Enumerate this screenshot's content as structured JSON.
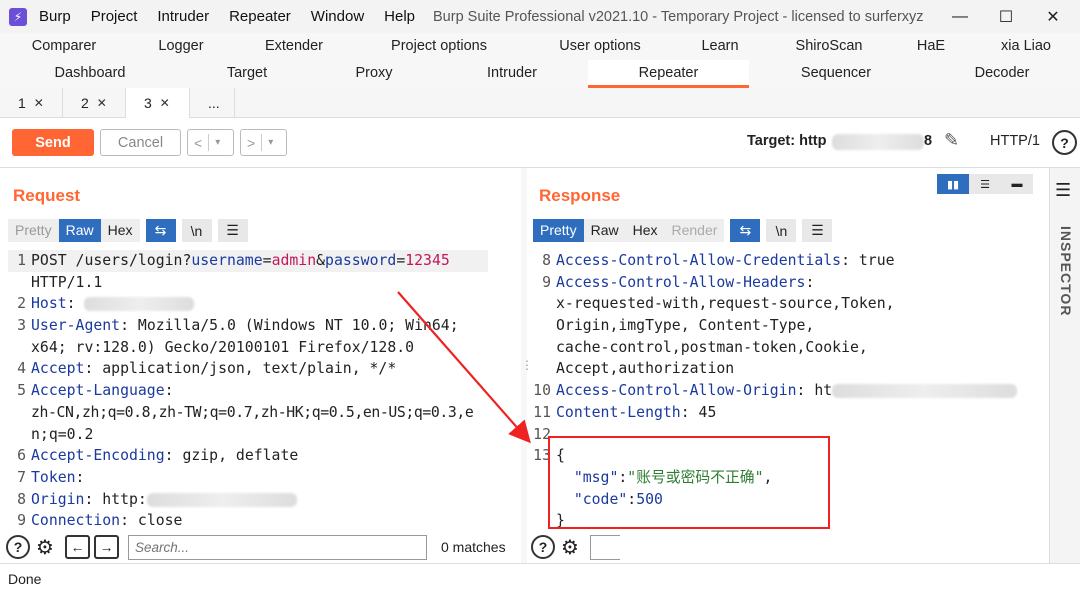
{
  "titlebar": {
    "menus": [
      "Burp",
      "Project",
      "Intruder",
      "Repeater",
      "Window",
      "Help"
    ],
    "title": "Burp Suite Professional v2021.10 - Temporary Project - licensed to surferxyz",
    "minimize": "—",
    "maximize": "☐",
    "close": "✕"
  },
  "tabs_row1": [
    "Comparer",
    "Logger",
    "Extender",
    "Project options",
    "User options",
    "Learn",
    "ShiroScan",
    "HaE",
    "xia Liao"
  ],
  "tabs_row2": [
    "Dashboard",
    "Target",
    "Proxy",
    "Intruder",
    "Repeater",
    "Sequencer",
    "Decoder"
  ],
  "active_tab": "Repeater",
  "subtabs": [
    {
      "label": "1"
    },
    {
      "label": "2"
    },
    {
      "label": "3"
    },
    {
      "label": "..."
    }
  ],
  "toolbar": {
    "send": "Send",
    "cancel": "Cancel",
    "target_label": "Target: http",
    "target_suffix": "8",
    "http_version": "HTTP/1",
    "help": "?"
  },
  "request": {
    "title": "Request",
    "view_tabs": [
      "Pretty",
      "Raw",
      "Hex"
    ],
    "active_view": "Raw",
    "search_placeholder": "Search...",
    "matches": "0 matches"
  },
  "response": {
    "title": "Response",
    "view_tabs": [
      "Pretty",
      "Raw",
      "Hex",
      "Render"
    ],
    "active_view": "Pretty"
  },
  "inspector": "INSPECTOR",
  "status": "Done",
  "accent": "#ff6633",
  "selected": "#2f6ebf"
}
